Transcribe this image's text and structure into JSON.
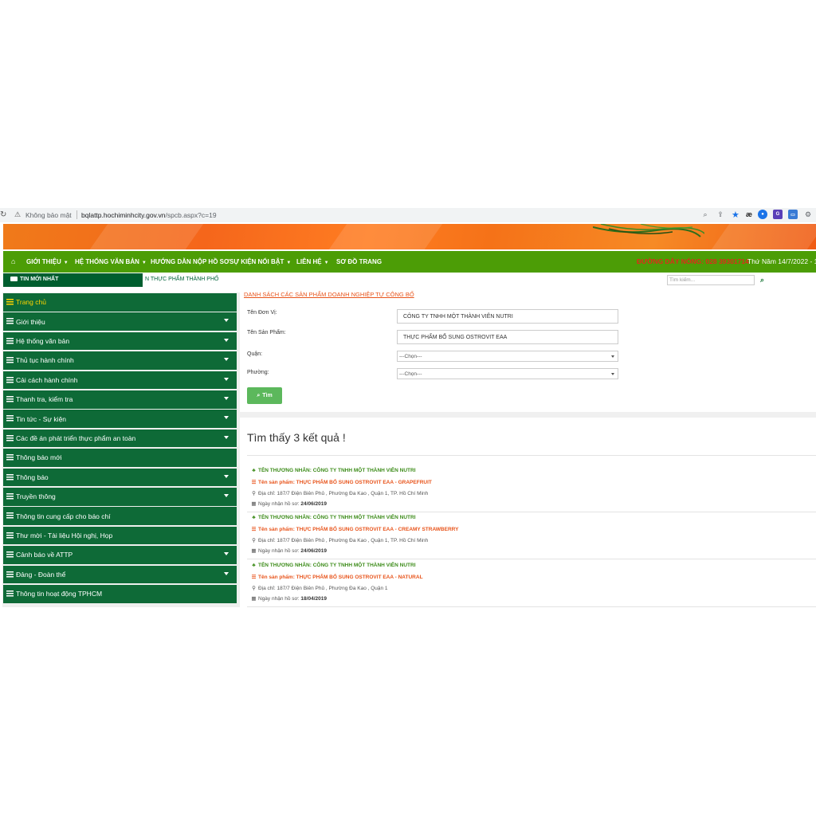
{
  "browser": {
    "security_label": "Không bảo mật",
    "url_host": "bqlattp.hochiminhcity.gov.vn",
    "url_path": "/spcb.aspx?c=19"
  },
  "nav": {
    "items": [
      {
        "label": "GIỚI THIỆU",
        "has_dropdown": true
      },
      {
        "label": "HỆ THỐNG VĂN BẢN",
        "has_dropdown": true
      },
      {
        "label": "HƯỚNG DẪN NỘP HỒ SƠ",
        "has_dropdown": false
      },
      {
        "label": "SỰ KIỆN NỔI BẬT",
        "has_dropdown": true
      },
      {
        "label": "LIÊN HỆ",
        "has_dropdown": true
      },
      {
        "label": "SƠ ĐỒ TRANG",
        "has_dropdown": false
      }
    ],
    "hotline": "ĐƯỜNG DÂY NÓNG: 028 39301714",
    "date": "Thứ Năm 14/7/2022 - 13"
  },
  "ticker": {
    "label": "TIN MỚI NHẤT",
    "text": "N THỰC PHẨM THÀNH PHỐ"
  },
  "search": {
    "placeholder": "Tìm kiếm..."
  },
  "sidebar": {
    "items": [
      {
        "label": "Trang chủ",
        "dropdown": false,
        "active": true
      },
      {
        "label": "Giới thiệu",
        "dropdown": true
      },
      {
        "label": "Hệ thống văn bản",
        "dropdown": true
      },
      {
        "label": "Thủ tục hành chính",
        "dropdown": true
      },
      {
        "label": "Cải cách hành chính",
        "dropdown": true
      },
      {
        "label": "Thanh tra, kiểm tra",
        "dropdown": true
      },
      {
        "label": "Tin tức - Sự kiện",
        "dropdown": true
      },
      {
        "label": "Các đề án phát triển thực phẩm an toàn",
        "dropdown": true
      },
      {
        "label": "Thông báo mới",
        "dropdown": false
      },
      {
        "label": "Thông báo",
        "dropdown": true
      },
      {
        "label": "Truyền thông",
        "dropdown": true
      },
      {
        "label": "Thông tin cung cấp cho báo chí",
        "dropdown": false
      },
      {
        "label": "Thư mời - Tài liệu Hội nghị, Họp",
        "dropdown": false
      },
      {
        "label": "Cảnh báo về ATTP",
        "dropdown": true
      },
      {
        "label": "Đảng - Đoàn thể",
        "dropdown": true
      },
      {
        "label": "Thông tin hoạt động TPHCM",
        "dropdown": false
      }
    ]
  },
  "form": {
    "title": "DANH SÁCH CÁC SẢN PHẨM DOANH NGHIỆP TỰ CÔNG BỐ",
    "unit_label": "Tên Đơn Vị:",
    "unit_value": "CÔNG TY TNHH MỘT THÀNH VIÊN NUTRI",
    "product_label": "Tên Sản Phẩm:",
    "product_value": "THỰC PHẨM BỔ SUNG OSTROVIT EAA",
    "district_label": "Quận:",
    "district_value": "---Chọn---",
    "ward_label": "Phường:",
    "ward_value": "---Chọn---",
    "submit_label": "Tìm"
  },
  "results": {
    "count_text": "Tìm thấy 3 kết quả !",
    "items": [
      {
        "merchant": "TÊN THƯƠNG NHÂN: CÔNG TY TNHH MỘT THÀNH VIÊN NUTRI",
        "product": "Tên sản phẩm: THỰC PHẨM BỔ SUNG OSTROVIT EAA - GRAPEFRUIT",
        "address": "Địa chỉ: 187/7 Điện Biên Phủ , Phường Đa Kao , Quận 1, TP. Hồ Chí Minh",
        "date_label": "Ngày nhận hồ sơ:",
        "date": "24/06/2019"
      },
      {
        "merchant": "TÊN THƯƠNG NHÂN: CÔNG TY TNHH MỘT THÀNH VIÊN NUTRI",
        "product": "Tên sản phẩm: THỰC PHẨM BỔ SUNG OSTROVIT EAA - CREAMY STRAWBERRY",
        "address": "Địa chỉ: 187/7 Điện Biên Phủ , Phường Đa Kao , Quận 1, TP. Hồ Chí Minh",
        "date_label": "Ngày nhận hồ sơ:",
        "date": "24/06/2019"
      },
      {
        "merchant": "TÊN THƯƠNG NHÂN: CÔNG TY TNHH MỘT THÀNH VIÊN NUTRI",
        "product": "Tên sản phẩm: THỰC PHẨM BỔ SUNG OSTROVIT EAA - NATURAL",
        "address": "Địa chỉ: 187/7 Điện Biên Phủ , Phường Đa Kao , Quận 1",
        "date_label": "Ngày nhận hồ sơ:",
        "date": "18/04/2019"
      }
    ]
  },
  "colors": {
    "nav_green": "#4c9d06",
    "sidebar_green": "#0e6a37",
    "accent_orange": "#e8541b",
    "hotline_red": "#e02a1b",
    "merchant_green": "#3d8c1a",
    "button_green": "#5cb85c"
  }
}
